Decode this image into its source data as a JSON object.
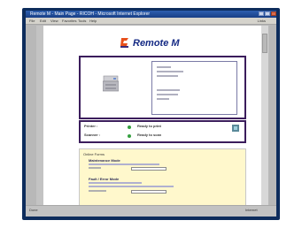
{
  "window": {
    "title": "Remote M - Main Page - RICOH - Microsoft Internet Explorer"
  },
  "menu": {
    "items": [
      "File",
      "Edit",
      "View",
      "Favorites",
      "Tools",
      "Help"
    ],
    "toolbar_right": "Links"
  },
  "brand": {
    "logo_text": "Remote M",
    "colors": {
      "logo": "#152a84",
      "border": "#3b1d5c",
      "forms_bg": "#fff8cc",
      "ok": "#35a040"
    }
  },
  "device": {
    "icon": "printer-icon"
  },
  "status": {
    "printer_label": "Printer :",
    "printer_value": "Ready to print",
    "scanner_label": "Scanner :",
    "scanner_value": "Ready to scan"
  },
  "forms": {
    "heading": "Online Forms",
    "form1_title": "Maintenance Mode",
    "form2_title": "Fault / Error Mode"
  },
  "statusbar": {
    "left": "Done",
    "right": "Internet"
  }
}
